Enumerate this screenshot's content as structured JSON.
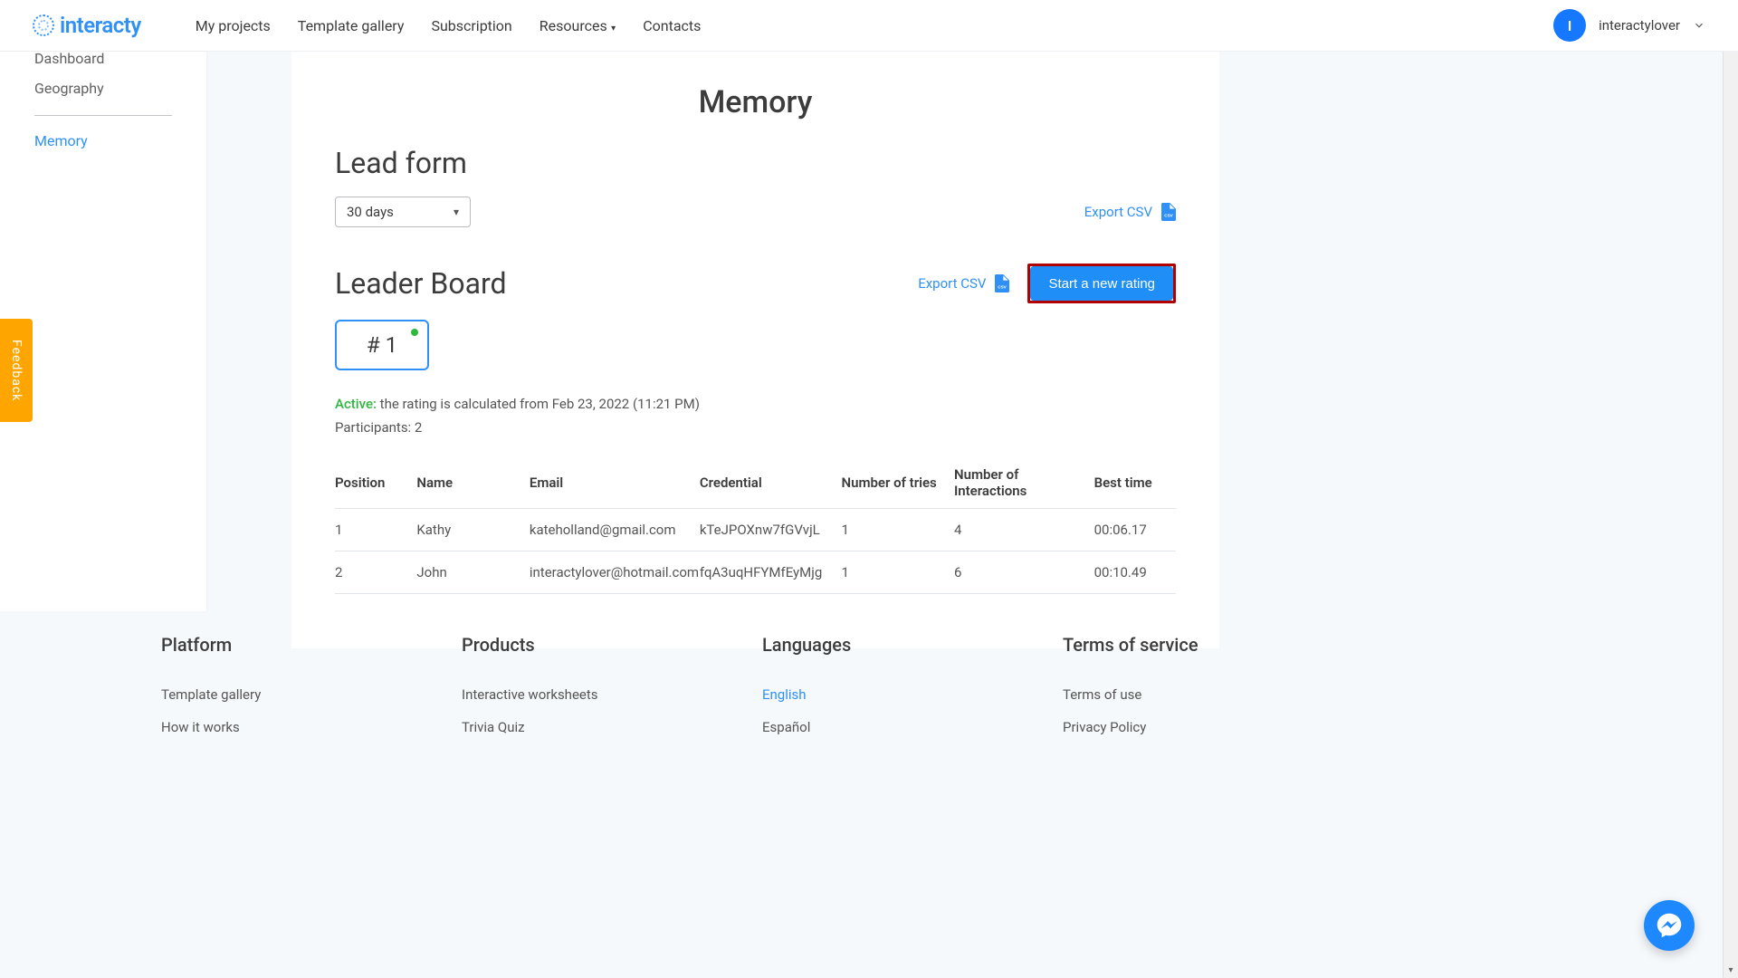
{
  "brand": {
    "name": "interacty",
    "avatar_letter": "I",
    "username": "interactylover"
  },
  "nav": {
    "my_projects": "My projects",
    "template_gallery": "Template gallery",
    "subscription": "Subscription",
    "resources": "Resources",
    "contacts": "Contacts"
  },
  "sidebar": {
    "dashboard": "Dashboard",
    "geography": "Geography",
    "memory": "Memory"
  },
  "page": {
    "title": "Memory",
    "leadform_title": "Lead form",
    "period": "30 days",
    "export_csv": "Export CSV",
    "leader_title": "Leader Board",
    "export_csv2": "Export CSV",
    "start_rating": "Start a new rating",
    "rating_chip": "# 1",
    "status_active": "Active:",
    "status_text": " the rating is calculated from Feb 23, 2022 (11:21 PM)",
    "participants": "Participants: 2"
  },
  "table": {
    "headers": {
      "position": "Position",
      "name": "Name",
      "email": "Email",
      "credential": "Credential",
      "tries": "Number of tries",
      "interactions": "Number of Interactions",
      "best_time": "Best time"
    },
    "rows": [
      {
        "position": "1",
        "name": "Kathy",
        "email": "kateholland@gmail.com",
        "credential": "kTeJPOXnw7fGVvjL",
        "tries": "1",
        "interactions": "4",
        "best_time": "00:06.17"
      },
      {
        "position": "2",
        "name": "John",
        "email": "interactylover@hotmail.com",
        "credential": "fqA3uqHFYMfEyMjg",
        "tries": "1",
        "interactions": "6",
        "best_time": "00:10.49"
      }
    ]
  },
  "footer": {
    "platform": {
      "title": "Platform",
      "template_gallery": "Template gallery",
      "how_it_works": "How it works"
    },
    "products": {
      "title": "Products",
      "worksheets": "Interactive worksheets",
      "trivia": "Trivia Quiz"
    },
    "languages": {
      "title": "Languages",
      "english": "English",
      "espanol": "Español"
    },
    "terms": {
      "title": "Terms of service",
      "terms_of_use": "Terms of use",
      "privacy": "Privacy Policy"
    }
  },
  "feedback_label": "Feedback"
}
